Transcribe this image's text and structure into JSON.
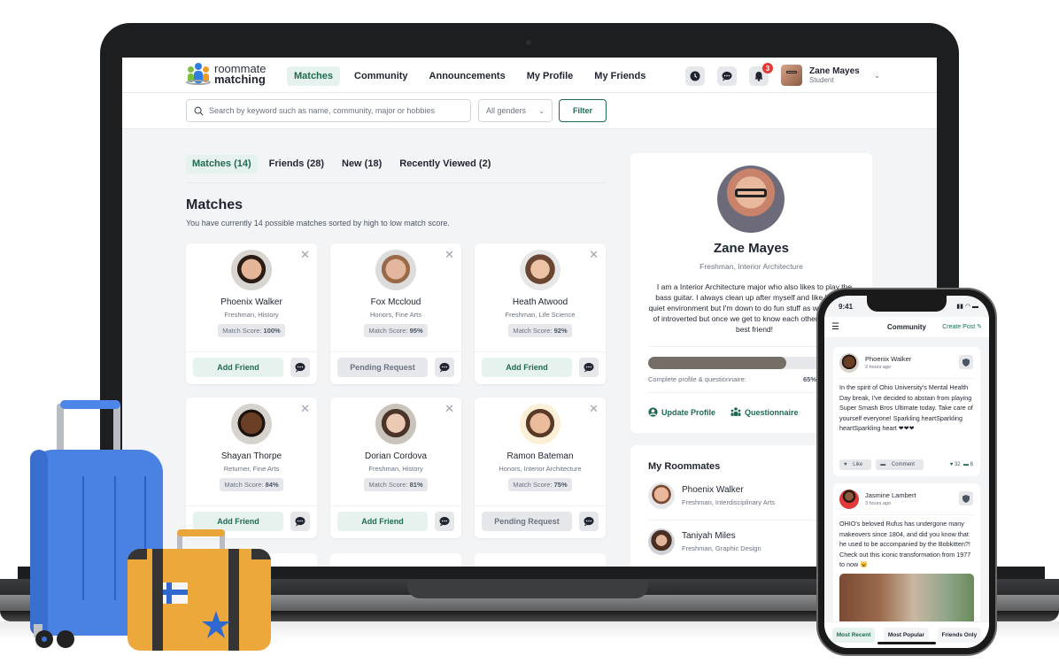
{
  "app": {
    "logo_line1": "roommate",
    "logo_line2": "matching"
  },
  "nav": {
    "links": [
      {
        "label": "Matches",
        "active": true
      },
      {
        "label": "Community",
        "active": false
      },
      {
        "label": "Announcements",
        "active": false
      },
      {
        "label": "My Profile",
        "active": false
      },
      {
        "label": "My Friends",
        "active": false
      }
    ],
    "icons": [
      "clock-icon",
      "chat-icon",
      "bell-icon"
    ],
    "notification_count": "3",
    "user": {
      "name": "Zane Mayes",
      "role": "Student"
    }
  },
  "search": {
    "placeholder": "Search by keyword such as name, community, major or hobbies",
    "gender_value": "All genders",
    "filter_label": "Filter"
  },
  "tabs": [
    {
      "label": "Matches (14)",
      "active": true
    },
    {
      "label": "Friends (28)",
      "active": false
    },
    {
      "label": "New (18)",
      "active": false
    },
    {
      "label": "Recently Viewed (2)",
      "active": false
    }
  ],
  "matches": {
    "title": "Matches",
    "subtitle": "You have currently 14 possible matches sorted by high to low match score.",
    "score_label": "Match Score:",
    "cards": [
      {
        "name": "Phoenix Walker",
        "major": "Freshman, History",
        "score": "100%",
        "action": "Add Friend",
        "status": "add"
      },
      {
        "name": "Fox Mccloud",
        "major": "Honors, Fine Arts",
        "score": "95%",
        "action": "Pending Request",
        "status": "pending"
      },
      {
        "name": "Heath Atwood",
        "major": "Freshman, Life Science",
        "score": "92%",
        "action": "Add Friend",
        "status": "add"
      },
      {
        "name": "Shayan Thorpe",
        "major": "Returner, Fine Arts",
        "score": "84%",
        "action": "Add Friend",
        "status": "add"
      },
      {
        "name": "Dorian Cordova",
        "major": "Freshman, History",
        "score": "81%",
        "action": "Add Friend",
        "status": "add"
      },
      {
        "name": "Ramon Bateman",
        "major": "Honors, Interior Architecture",
        "score": "75%",
        "action": "Pending Request",
        "status": "pending"
      }
    ]
  },
  "profile": {
    "name": "Zane Mayes",
    "major": "Freshman, Interior Architecture",
    "bio": "I am a Interior Architecture major who also likes to play the bass guitar. I always clean up after myself and like having a quiet environment but I'm down to do fun stuff as well! I am kind of introverted but once we get to know each other, I'll be your best friend!",
    "progress_label": "Complete profile & questionnaire:",
    "progress_value": "65%",
    "progress_fraction": 0.65,
    "update_label": "Update Profile",
    "questionnaire_label": "Questionnaire"
  },
  "roommates": {
    "title": "My Roommates",
    "items": [
      {
        "name": "Phoenix Walker",
        "major": "Freshman, Interdisciplinary Arts"
      },
      {
        "name": "Taniyah Miles",
        "major": "Freshman, Graphic Design"
      }
    ]
  },
  "phone": {
    "time": "9:41",
    "title": "Community",
    "create_post": "Create Post",
    "posts": [
      {
        "author": "Phoenix Walker",
        "time": "2 hours ago",
        "text": "In the spirit of Ohio University's Mental Health Day break, I've decided to abstain from playing Super Smash Bros Ultimate today. Take care of yourself everyone! Sparkling heartSparkling heartSparkling heart ❤❤❤",
        "like": "Like",
        "comment": "Comment",
        "likes": "32",
        "comments": "8"
      },
      {
        "author": "Jasmine Lambert",
        "time": "3 hours ago",
        "text": "OHIO's beloved Rufus has undergone many makeovers since 1804, and did you know that he used to be accompanied by the Bobkitten?! Check out this iconic transformation from 1977 to now 😺"
      }
    ],
    "tabs": [
      {
        "label": "Most Recent",
        "active": true
      },
      {
        "label": "Most Popular",
        "active": false
      },
      {
        "label": "Friends Only",
        "active": false
      }
    ]
  }
}
